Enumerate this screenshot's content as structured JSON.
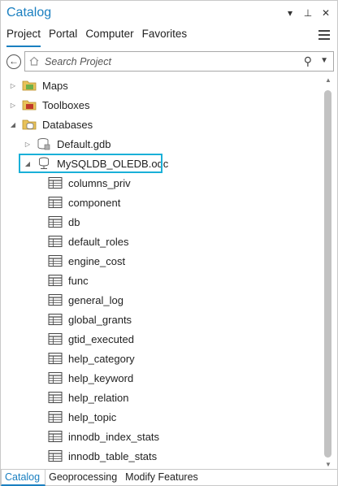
{
  "window": {
    "title": "Catalog",
    "controls": [
      "▾",
      "⊥",
      "✕"
    ]
  },
  "tabs": [
    {
      "label": "Project",
      "active": true
    },
    {
      "label": "Portal",
      "active": false
    },
    {
      "label": "Computer",
      "active": false
    },
    {
      "label": "Favorites",
      "active": false
    }
  ],
  "search": {
    "placeholder": "Search Project"
  },
  "tree": {
    "top": [
      {
        "label": "Maps",
        "twisty": "▷",
        "icon": "maps-folder-icon"
      },
      {
        "label": "Toolboxes",
        "twisty": "▷",
        "icon": "toolbox-folder-icon"
      },
      {
        "label": "Databases",
        "twisty": "◢",
        "icon": "database-folder-icon"
      }
    ],
    "databases": [
      {
        "label": "Default.gdb",
        "twisty": "▷",
        "icon": "geodatabase-icon"
      },
      {
        "label": "MySQLDB_OLEDB.odc",
        "twisty": "◢",
        "icon": "database-connection-icon",
        "selected": true
      }
    ],
    "tables": [
      "columns_priv",
      "component",
      "db",
      "default_roles",
      "engine_cost",
      "func",
      "general_log",
      "global_grants",
      "gtid_executed",
      "help_category",
      "help_keyword",
      "help_relation",
      "help_topic",
      "innodb_index_stats",
      "innodb_table_stats"
    ]
  },
  "bottom_tabs": [
    {
      "label": "Catalog",
      "active": true
    },
    {
      "label": "Geoprocessing",
      "active": false
    },
    {
      "label": "Modify Features",
      "active": false
    }
  ],
  "colors": {
    "accent": "#1a7fc0",
    "selection": "#1ab0d8"
  }
}
